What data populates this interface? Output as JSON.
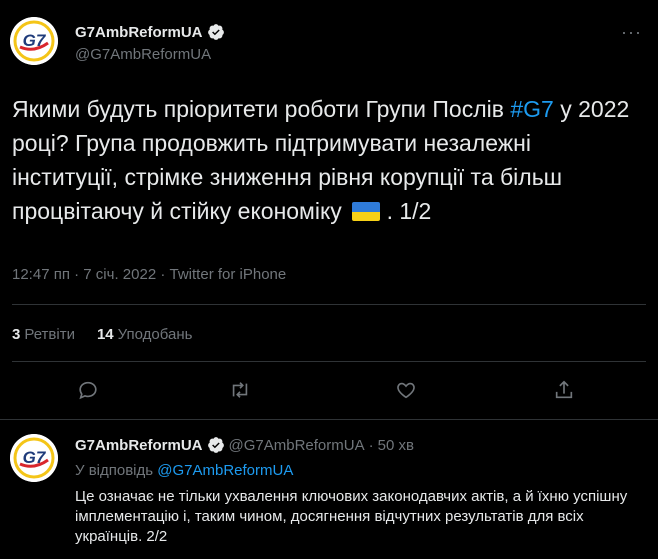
{
  "main_tweet": {
    "author_name": "G7AmbReformUA",
    "handle": "@G7AmbReformUA",
    "avatar_text": "G7",
    "text_before_tag": "Якими будуть пріоритети роботи Групи Послів ",
    "hashtag": "#G7",
    "text_after_tag": " у 2022 році? Група продовжить підтримувати незалежні інституції, стрімке зниження рівня корупції та більш процвітаючу й стійку економіку",
    "text_end": " . 1/2",
    "time": "12:47 пп",
    "separator": "·",
    "date": "7 січ. 2022",
    "source": "Twitter for iPhone",
    "retweets_count": "3",
    "retweets_label": "Ретвіти",
    "likes_count": "14",
    "likes_label": "Уподобань",
    "more": "···"
  },
  "reply_tweet": {
    "author_name": "G7AmbReformUA",
    "handle": "@G7AmbReformUA",
    "separator": "·",
    "time_ago": "50 хв",
    "replying_to_label": "У відповідь",
    "replying_to_handle": "@G7AmbReformUA",
    "text": "Це означає не тільки ухвалення ключових законодавчих актів, а й їхню успішну імплементацію і, таким чином, досягнення відчутних результатів для всіх українців. 2/2"
  },
  "colors": {
    "background": "#000000",
    "text": "#e7e9ea",
    "muted": "#71767b",
    "accent": "#1d9bf0",
    "divider": "#2f3336",
    "avatar_blue": "#1f3b7a",
    "avatar_red": "#d9262c",
    "avatar_yellow": "#f4c518"
  },
  "icons": [
    "verified-icon",
    "more-icon",
    "reply-icon",
    "retweet-icon",
    "like-icon",
    "share-icon",
    "ukraine-flag-emoji"
  ]
}
